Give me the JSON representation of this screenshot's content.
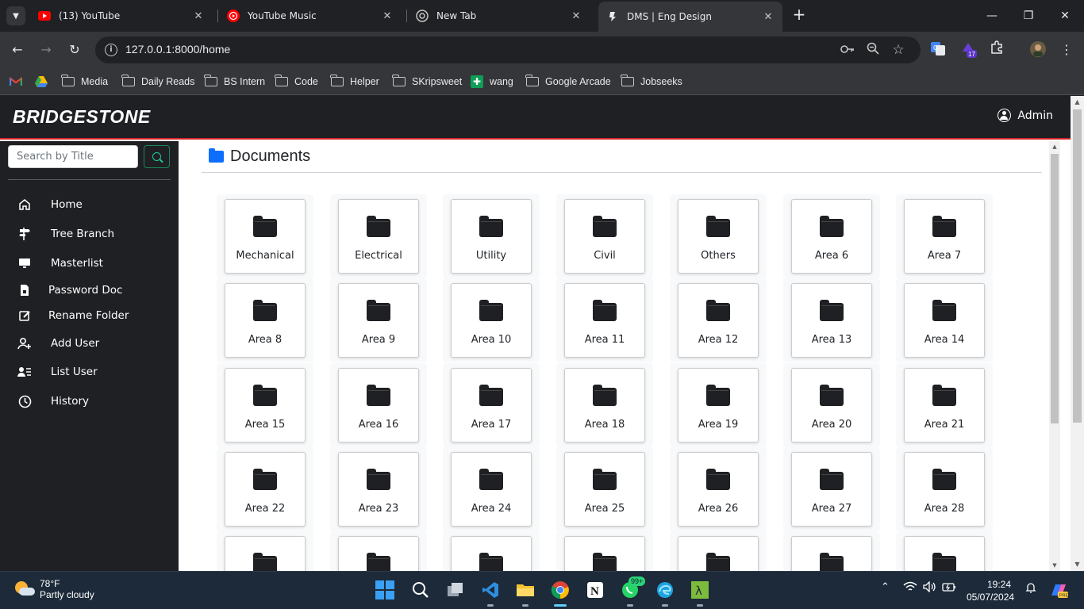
{
  "browser": {
    "tabs": [
      {
        "title": "(13) YouTube",
        "favicon": "youtube-icon"
      },
      {
        "title": "YouTube Music",
        "favicon": "youtube-music-icon"
      },
      {
        "title": "New Tab",
        "favicon": "chrome-icon"
      },
      {
        "title": "DMS | Eng Design",
        "favicon": "bridgestone-icon",
        "active": true
      }
    ],
    "url": "127.0.0.1:8000/home",
    "bookmarks": [
      "Media",
      "Daily Reads",
      "BS Intern",
      "Code",
      "Helper",
      "SKripsweet",
      "wang",
      "Google Arcade",
      "Jobseeks"
    ],
    "extension_badge": "17",
    "colors": {
      "tab_bar": "#202124",
      "toolbar": "#35363a"
    }
  },
  "app": {
    "brand": "BRIDGESTONE",
    "user": "Admin",
    "search_placeholder": "Search by Title",
    "nav": [
      {
        "label": "Home",
        "icon": "home-icon"
      },
      {
        "label": "Tree Branch",
        "icon": "signpost-icon"
      },
      {
        "label": "Masterlist",
        "icon": "monitor-icon"
      },
      {
        "label": "Password Doc",
        "icon": "file-lock-icon"
      },
      {
        "label": "Rename Folder",
        "icon": "edit-icon"
      },
      {
        "label": "Add User",
        "icon": "add-user-icon"
      },
      {
        "label": "List User",
        "icon": "user-list-icon"
      },
      {
        "label": "History",
        "icon": "clock-icon"
      }
    ],
    "page_title": "Documents",
    "folders": [
      "Mechanical",
      "Electrical",
      "Utility",
      "Civil",
      "Others",
      "Area 6",
      "Area 7",
      "Area 8",
      "Area 9",
      "Area 10",
      "Area 11",
      "Area 12",
      "Area 13",
      "Area 14",
      "Area 15",
      "Area 16",
      "Area 17",
      "Area 18",
      "Area 19",
      "Area 20",
      "Area 21",
      "Area 22",
      "Area 23",
      "Area 24",
      "Area 25",
      "Area 26",
      "Area 27",
      "Area 28",
      "",
      "",
      "",
      "",
      "",
      "",
      ""
    ],
    "colors": {
      "header": "#1f2024",
      "accent": "#d6242a",
      "folder_blue": "#0d6efd",
      "search_green": "#198754"
    }
  },
  "taskbar": {
    "weather_temp": "78°F",
    "weather_desc": "Partly cloudy",
    "time": "19:24",
    "date": "05/07/2024",
    "whatsapp_badge": "99+"
  }
}
